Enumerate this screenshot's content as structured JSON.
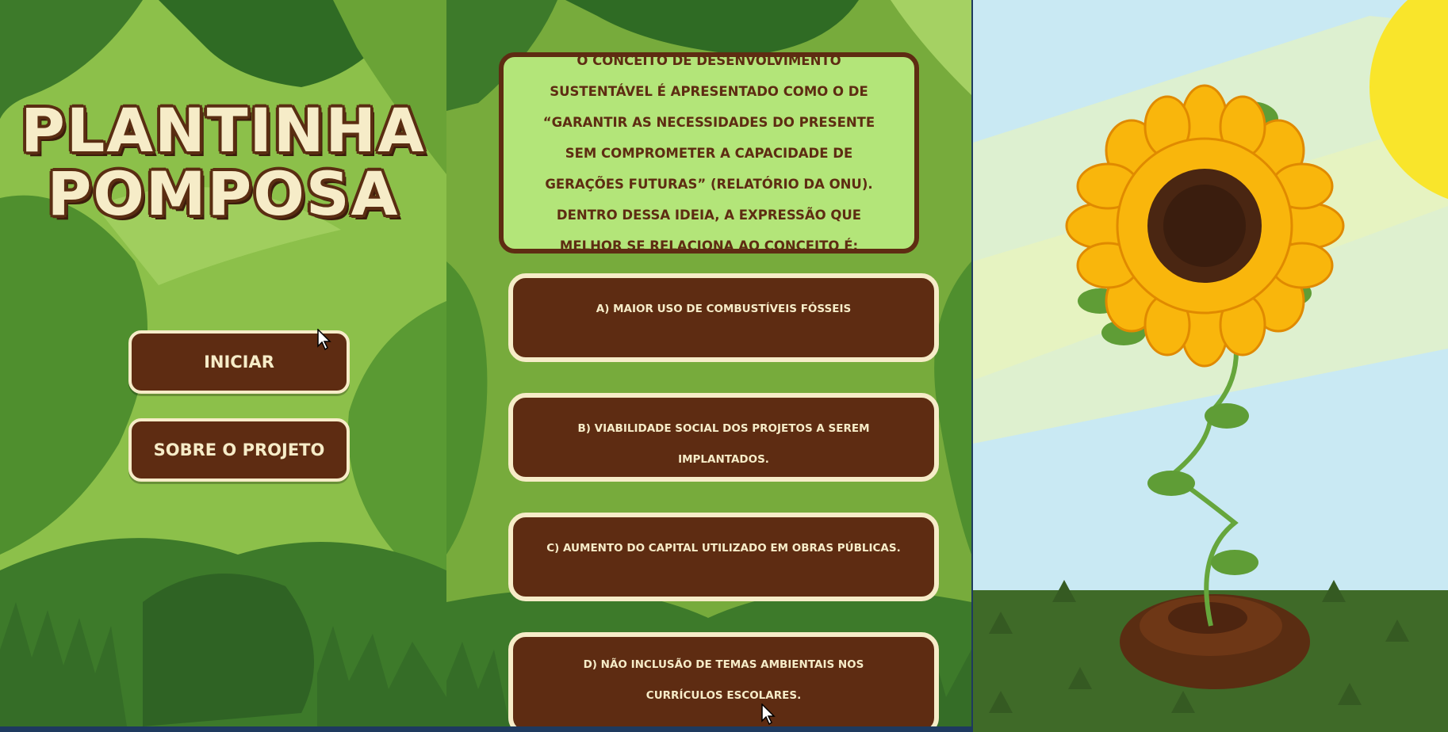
{
  "menu_screen": {
    "title_line1": "PLANTINHA",
    "title_line2": "POMPOSA",
    "start_button": "INICIAR",
    "about_button": "SOBRE O PROJETO"
  },
  "quiz_screen": {
    "question": "O CONCEITO DE DESENVOLVIMENTO SUSTENTÁVEL É APRESENTADO COMO O DE “GARANTIR AS NECESSIDADES DO PRESENTE SEM COMPROMETER A CAPACIDADE DE GERAÇÕES FUTURAS” (RELATÓRIO DA ONU). DENTRO DESSA IDEIA, A EXPRESSÃO QUE MELHOR SE RELACIONA AO CONCEITO É:",
    "answers": [
      "A) MAIOR USO DE COMBUSTÍVEIS FÓSSEIS",
      "B) VIABILIDADE SOCIAL DOS PROJETOS A SEREM IMPLANTADOS.",
      "C) AUMENTO DO CAPITAL UTILIZADO EM OBRAS PÚBLICAS.",
      "D) NÃO INCLUSÃO DE TEMAS AMBIENTAIS NOS CURRÍCULOS ESCOLARES."
    ]
  },
  "colors": {
    "brown": "#5e2c12",
    "cream": "#f6ecc8",
    "light_green": "#b3e579",
    "sky": "#c9e9f3",
    "grass": "#3f6a28",
    "petal": "#f9b60c"
  },
  "icons": [
    "cursor-icon",
    "sunflower-illustration",
    "sun-illustration"
  ]
}
